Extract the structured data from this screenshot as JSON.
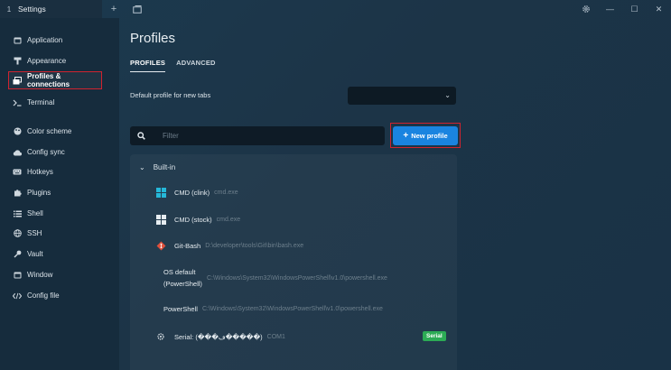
{
  "titlebar": {
    "tab_number": "1",
    "tab_title": "Settings",
    "icons": [
      "plus-icon",
      "window-icon",
      "gear-icon",
      "minimize-icon",
      "maximize-icon",
      "close-icon"
    ]
  },
  "sidebar": {
    "items": [
      {
        "label": "Application",
        "icon": "window-icon"
      },
      {
        "label": "Appearance",
        "icon": "paint-icon"
      },
      {
        "label": "Profiles & connections",
        "icon": "windows-stack-icon"
      },
      {
        "label": "Terminal",
        "icon": "terminal-icon"
      },
      {
        "label": "Color scheme",
        "icon": "palette-icon"
      },
      {
        "label": "Config sync",
        "icon": "cloud-sync-icon"
      },
      {
        "label": "Hotkeys",
        "icon": "keyboard-icon"
      },
      {
        "label": "Plugins",
        "icon": "puzzle-icon"
      },
      {
        "label": "Shell",
        "icon": "list-icon"
      },
      {
        "label": "SSH",
        "icon": "globe-icon"
      },
      {
        "label": "Vault",
        "icon": "key-icon"
      },
      {
        "label": "Window",
        "icon": "window-icon"
      },
      {
        "label": "Config file",
        "icon": "code-icon"
      }
    ]
  },
  "main": {
    "title": "Profiles",
    "tabs": [
      {
        "label": "PROFILES"
      },
      {
        "label": "ADVANCED"
      }
    ],
    "default_profile_label": "Default profile for new tabs",
    "default_profile_value": "",
    "filter_placeholder": "Filter",
    "new_profile_label": "New profile",
    "group_label": "Built-in",
    "profiles": [
      {
        "name": "CMD (clink)",
        "command": "cmd.exe",
        "icon": "windows-logo-icon"
      },
      {
        "name": "CMD (stock)",
        "command": "cmd.exe",
        "icon": "windows-logo-icon"
      },
      {
        "name": "Git-Bash",
        "command": "D:\\developer\\tools\\Git\\bin\\bash.exe",
        "icon": "git-icon"
      },
      {
        "name": "OS default (PowerShell)",
        "name_line1": "OS default",
        "name_line2": "(PowerShell)",
        "command": "C:\\Windows\\System32\\WindowsPowerShell\\v1.0\\powershell.exe"
      },
      {
        "name": "PowerShell",
        "command": "C:\\Windows\\System32\\WindowsPowerShell\\v1.0\\powershell.exe"
      },
      {
        "name": "Serial: (���ڡ�����)",
        "command": "COM1",
        "icon": "serial-port-icon",
        "badge": "Serial"
      }
    ]
  },
  "colors": {
    "accent": "#1a84e0",
    "highlight_border": "#d0232f",
    "badge_green": "#2cab55",
    "sidebar_bg": "#162c3d"
  }
}
